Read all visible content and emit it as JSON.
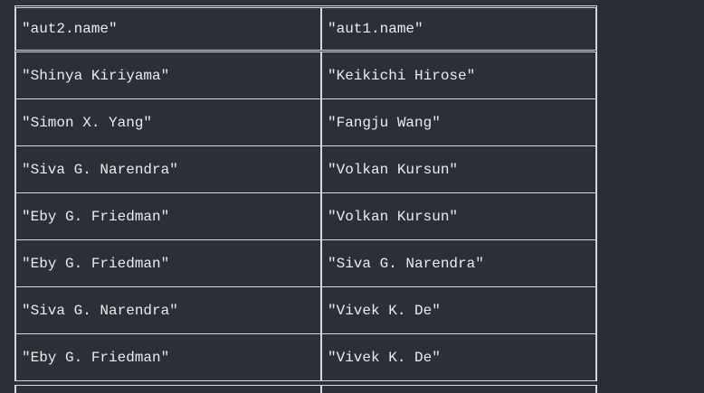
{
  "table": {
    "headers": [
      "\"aut2.name\"",
      "\"aut1.name\""
    ],
    "rows": [
      [
        "\"Shinya Kiriyama\"",
        "\"Keikichi Hirose\""
      ],
      [
        "\"Simon X. Yang\"",
        "\"Fangju Wang\""
      ],
      [
        "\"Siva G. Narendra\"",
        "\"Volkan Kursun\""
      ],
      [
        "\"Eby G. Friedman\"",
        "\"Volkan Kursun\""
      ],
      [
        "\"Eby G. Friedman\"",
        "\"Siva G. Narendra\""
      ],
      [
        "\"Siva G. Narendra\"",
        "\"Vivek K. De\""
      ],
      [
        "\"Eby G. Friedman\"",
        "\"Vivek K. De\""
      ]
    ]
  }
}
